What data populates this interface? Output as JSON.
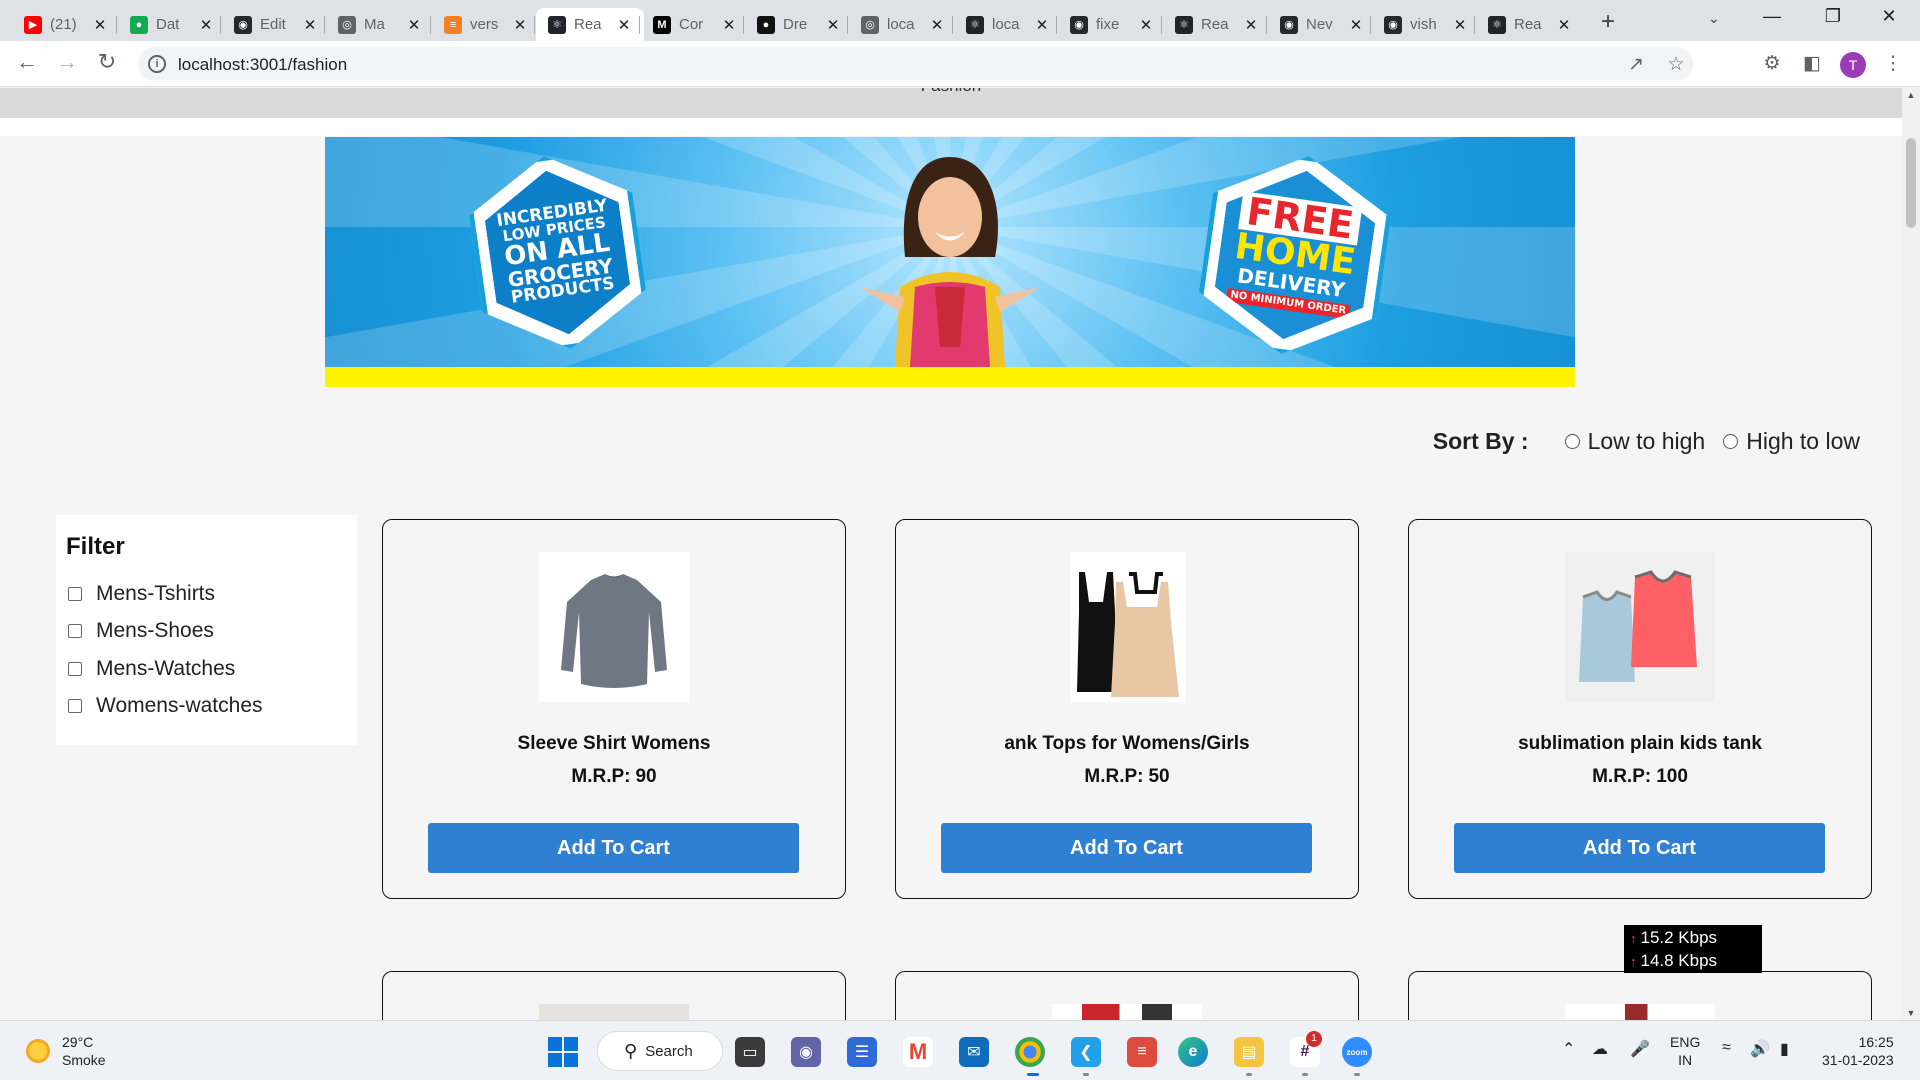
{
  "browser": {
    "tabs": [
      {
        "title": "(21)",
        "favicon": "youtube-icon",
        "color": "#ff0000"
      },
      {
        "title": "Dat",
        "favicon": "mongodb-icon",
        "color": "#13aa52"
      },
      {
        "title": "Edit",
        "favicon": "github-icon",
        "color": "#24292f"
      },
      {
        "title": "Ma",
        "favicon": "globe-icon",
        "color": "#5f6368"
      },
      {
        "title": "vers",
        "favicon": "stackoverflow-icon",
        "color": "#f48024"
      },
      {
        "title": "Rea",
        "favicon": "react-icon",
        "color": "#20232a"
      },
      {
        "title": "Cor",
        "favicon": "medium-icon",
        "color": "#000000"
      },
      {
        "title": "Dre",
        "favicon": "vercel-icon",
        "color": "#111111"
      },
      {
        "title": "loca",
        "favicon": "globe-icon",
        "color": "#5f6368"
      },
      {
        "title": "loca",
        "favicon": "react-icon",
        "color": "#20232a"
      },
      {
        "title": "fixe",
        "favicon": "github-icon",
        "color": "#24292f"
      },
      {
        "title": "Rea",
        "favicon": "react-icon",
        "color": "#20232a"
      },
      {
        "title": "Nev",
        "favicon": "github-icon",
        "color": "#24292f"
      },
      {
        "title": "vish",
        "favicon": "github-icon",
        "color": "#24292f"
      },
      {
        "title": "Rea",
        "favicon": "react-icon",
        "color": "#20232a"
      }
    ],
    "active_tab_index": 5,
    "url": "localhost:3001/fashion",
    "avatar_letter": "T"
  },
  "page": {
    "nav_text": "Fashion",
    "banner": {
      "left_badge": [
        "INCREDIBLY",
        "LOW PRICES",
        "ON ALL",
        "GROCERY",
        "PRODUCTS"
      ],
      "right_badge": [
        "FREE",
        "HOME",
        "DELIVERY",
        "NO MINIMUM ORDER"
      ]
    },
    "sort": {
      "label": "Sort By :",
      "options": [
        "Low to high",
        "High to low"
      ]
    },
    "filter": {
      "title": "Filter",
      "options": [
        "Mens-Tshirts",
        "Mens-Shoes",
        "Mens-Watches",
        "Womens-watches"
      ]
    },
    "price_label": "M.R.P:",
    "add_to_cart": "Add To Cart",
    "products": [
      {
        "name": "Sleeve Shirt Womens",
        "price": "90",
        "image": "grey-long-sleeve-tshirt"
      },
      {
        "name": "ank Tops for Womens/Girls",
        "price": "50",
        "image": "black-and-beige-camisoles"
      },
      {
        "name": "sublimation plain kids tank",
        "price": "100",
        "image": "blue-and-pink-kids-tanks"
      }
    ],
    "network_speed": {
      "up": "15.2 Kbps",
      "down": "14.8 Kbps"
    }
  },
  "taskbar": {
    "weather": {
      "temp": "29°C",
      "condition": "Smoke"
    },
    "search_label": "Search",
    "lang": [
      "ENG",
      "IN"
    ],
    "time": "16:25",
    "date": "31-01-2023",
    "slack_badge": "1"
  },
  "colors": {
    "button": "#2f7fd3",
    "banner_blue": "#1d9ee0",
    "banner_yellow": "#fff200",
    "free_red": "#e8262b",
    "home_yellow": "#ffe600"
  }
}
